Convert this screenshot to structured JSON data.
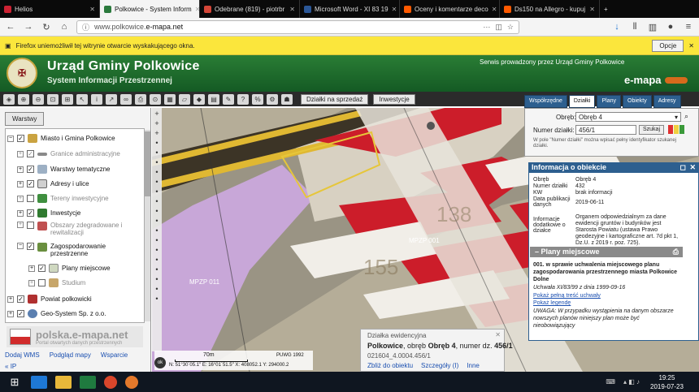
{
  "browser": {
    "tabs": [
      {
        "label": "Helios",
        "color": "#cc2233"
      },
      {
        "label": "Polkowice - System Inform",
        "color": "#2b7a3d",
        "active": true
      },
      {
        "label": "Odebrane (819) - piotrbr",
        "color": "#d44638"
      },
      {
        "label": "Microsoft Word - XI 83 19",
        "color": "#2b5797"
      },
      {
        "label": "Oceny i komentarze deco",
        "color": "#ff5a00"
      },
      {
        "label": "Ds150 na Allegro - kupuj",
        "color": "#ff5a00"
      }
    ],
    "url_prefix": "www.polkowice.",
    "url_domain": "e-mapa.net",
    "notification": "Firefox uniemożliwił tej witrynie otwarcie wyskakującego okna.",
    "options_label": "Opcje"
  },
  "header": {
    "title": "Urząd Gminy Polkowice",
    "subtitle": "System Informacji Przestrzennej",
    "service": "Serwis prowadzony przez Urząd Gminy Polkowice",
    "brand": "e-mapa"
  },
  "toolbar": {
    "sale_button": "Działki na sprzedaż",
    "invest_button": "Inwestycje"
  },
  "layers_panel": {
    "tab": "Warstwy",
    "items": [
      {
        "label": "Miasto i Gmina Polkowice",
        "checked": true,
        "dim": false
      },
      {
        "label": "Granice administracyjne",
        "checked": true,
        "dim": true
      },
      {
        "label": "Warstwy tematyczne",
        "checked": true,
        "dim": false
      },
      {
        "label": "Adresy i ulice",
        "checked": true,
        "dim": false
      },
      {
        "label": "Tereny inwestycyjne",
        "checked": false,
        "dim": true
      },
      {
        "label": "Inwestycje",
        "checked": true,
        "dim": false
      },
      {
        "label": "Obszary zdegradowane i rewitalizacji",
        "checked": false,
        "dim": true
      },
      {
        "label": "Zagospodarowanie przestrzenne",
        "checked": true,
        "dim": false
      },
      {
        "label": "Plany miejscowe",
        "checked": true,
        "dim": false
      },
      {
        "label": "Studium",
        "checked": false,
        "dim": true
      },
      {
        "label": "Powiat polkowicki",
        "checked": true,
        "dim": false
      },
      {
        "label": "Geo-System Sp. z o.o.",
        "checked": true,
        "dim": false
      }
    ],
    "portal_title": "polska.e-mapa.net",
    "portal_sub": "Portal otwartych danych przestrzennych",
    "links": [
      "Dodaj WMS",
      "Podgląd mapy",
      "Wsparcie"
    ],
    "ip": "IP"
  },
  "map": {
    "label_a": "MPZP 011",
    "label_b": "MPZP 001",
    "scale_label": "70m",
    "coords": "N: 51°30´05.1″  E: 16°01´51.5″  X: 408052.1  Y: 294000.2",
    "system": "PUWG 1992"
  },
  "parcel_popup": {
    "title": "Działka ewidencyjna",
    "town": "Polkowice",
    "region_label": "obręb",
    "region": "Obręb 4",
    "number_label": "numer dz.",
    "number": "456/1",
    "id": "021604_4.0004.456/1",
    "links": [
      "Zbliż do obiektu",
      "Szczegóły (I)",
      "Inne"
    ]
  },
  "right_panel": {
    "tabs": [
      "Współrzędne",
      "Działki",
      "Plany",
      "Obiekty",
      "Adresy"
    ],
    "region_label": "Obręb:",
    "region_value": "Obręb 4",
    "parcel_label": "Numer działki:",
    "parcel_value": "456/1",
    "search_button": "Szukaj",
    "hint": "W pole \"Numer działki\" można wpisać pełny identyfikator szukanej działki."
  },
  "info_panel": {
    "title": "Informacja o obiekcie",
    "rows": [
      {
        "k": "Obręb",
        "v": "Obręb 4"
      },
      {
        "k": "Numer działki",
        "v": "432"
      },
      {
        "k": "KW",
        "v": "brak informacji"
      },
      {
        "k": "Data publikacji danych",
        "v": "2019-06-11"
      },
      {
        "k": "Informacje dodatkowe o działce",
        "v": "Organem odpowiedzialnym za dane ewidencji gruntów i budynków jest Starosta Powiatu (ustawa Prawo geodezyjne i kartograficzne art. 7d pkt 1, Dz.U. z 2019 r. poz. 725)."
      }
    ],
    "plans_header": "Plany miejscowe",
    "plan_title": "001. w sprawie uchwalenia miejscowego planu zagospodarowania przestrzennego miasta Polkowice Dolne",
    "plan_resolution": "Uchwała XI/83/99 z dnia 1999-09-16",
    "link_full": "Pokaż pełną treść uchwały",
    "link_legend": "Pokaż legendę",
    "warning": "UWAGA: W przypadku wystąpienia na danym obszarze nowszych planów niniejszy plan może być nieobowiązujący"
  },
  "taskbar": {
    "time": "19:25",
    "date": "2019-07-23"
  }
}
